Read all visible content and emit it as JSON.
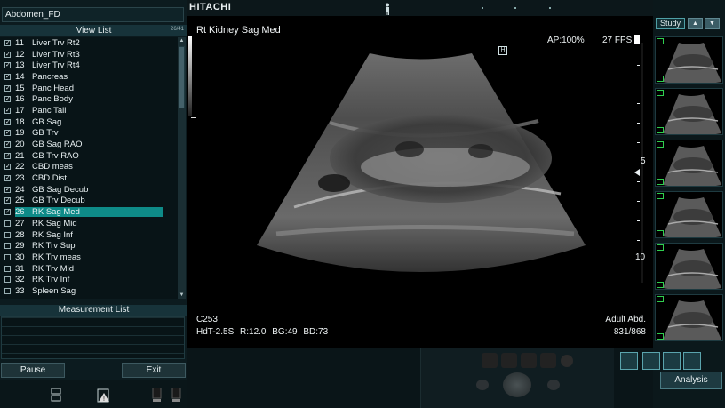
{
  "protocol": {
    "name": "Abdomen_FD"
  },
  "view_list": {
    "title": "View List",
    "counter": "26/41",
    "items": [
      {
        "num": "11",
        "label": "Liver Trv Rt2",
        "checked": true
      },
      {
        "num": "12",
        "label": "Liver Trv Rt3",
        "checked": true
      },
      {
        "num": "13",
        "label": "Liver Trv Rt4",
        "checked": true
      },
      {
        "num": "14",
        "label": "Pancreas",
        "checked": true
      },
      {
        "num": "15",
        "label": "Panc Head",
        "checked": true
      },
      {
        "num": "16",
        "label": "Panc Body",
        "checked": true
      },
      {
        "num": "17",
        "label": "Panc Tail",
        "checked": true
      },
      {
        "num": "18",
        "label": "GB Sag",
        "checked": true
      },
      {
        "num": "19",
        "label": "GB Trv",
        "checked": true
      },
      {
        "num": "20",
        "label": "GB Sag RAO",
        "checked": true
      },
      {
        "num": "21",
        "label": "GB Trv RAO",
        "checked": true
      },
      {
        "num": "22",
        "label": "CBD meas",
        "checked": true
      },
      {
        "num": "23",
        "label": "CBD Dist",
        "checked": true
      },
      {
        "num": "24",
        "label": "GB Sag Decub",
        "checked": true
      },
      {
        "num": "25",
        "label": "GB Trv Decub",
        "checked": true
      },
      {
        "num": "26",
        "label": "RK Sag Med",
        "checked": true,
        "selected": true
      },
      {
        "num": "27",
        "label": "RK Sag Mid",
        "checked": false
      },
      {
        "num": "28",
        "label": "RK Sag Inf",
        "checked": false
      },
      {
        "num": "29",
        "label": "RK Trv Sup",
        "checked": false
      },
      {
        "num": "30",
        "label": "RK Trv meas",
        "checked": false
      },
      {
        "num": "31",
        "label": "RK Trv Mid",
        "checked": false
      },
      {
        "num": "32",
        "label": "RK Trv Inf",
        "checked": false
      },
      {
        "num": "33",
        "label": "Spleen Sag",
        "checked": false
      }
    ]
  },
  "measurement_list": {
    "title": "Measurement List"
  },
  "buttons": {
    "pause": "Pause",
    "exit": "Exit",
    "study": "Study",
    "analysis": "Analysis"
  },
  "topbar": {
    "brand": "HITACHI"
  },
  "image": {
    "title": "Rt Kidney Sag Med",
    "ap": "AP:100%",
    "fps": "27 FPS",
    "fps_indicator": "1",
    "h_marker": "H",
    "probe": "C253",
    "params": "HdT-2.5S    R:12.0  BG:49  BD:73",
    "preset": "Adult Abd.",
    "frame_counter": "831/868",
    "depth_5": "5",
    "depth_10": "10"
  },
  "icons": {
    "up_arrow": "up-arrow-icon",
    "down_arrow": "down-arrow-icon",
    "body_mark": "body-mark-icon",
    "warning": "warning-icon"
  },
  "colors": {
    "selection": "#0e8b88",
    "accent": "#4fa0a6",
    "thumb_marker": "#2fcf4f"
  }
}
